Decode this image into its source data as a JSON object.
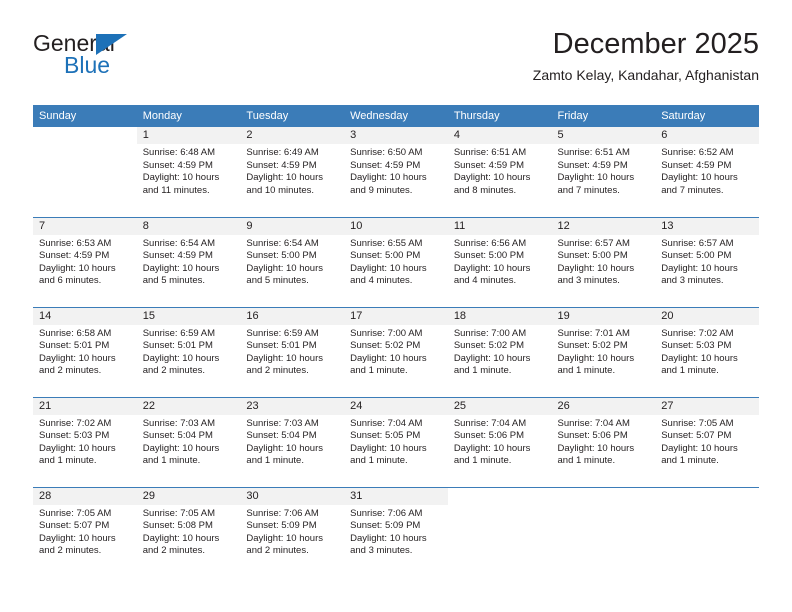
{
  "brand": {
    "name_part1": "General",
    "name_part2": "Blue",
    "triangle_icon": "triangle-icon",
    "colors": {
      "dark": "#231f20",
      "blue": "#1d71b8"
    }
  },
  "header": {
    "title": "December 2025",
    "subtitle": "Zamto Kelay, Kandahar, Afghanistan"
  },
  "calendar": {
    "header_bg": "#3b7cb8",
    "daynum_bg": "#f2f2f2",
    "weekdays": [
      "Sunday",
      "Monday",
      "Tuesday",
      "Wednesday",
      "Thursday",
      "Friday",
      "Saturday"
    ],
    "weeks": [
      [
        {
          "day": ""
        },
        {
          "day": "1",
          "sunrise": "Sunrise: 6:48 AM",
          "sunset": "Sunset: 4:59 PM",
          "daylight1": "Daylight: 10 hours",
          "daylight2": "and 11 minutes."
        },
        {
          "day": "2",
          "sunrise": "Sunrise: 6:49 AM",
          "sunset": "Sunset: 4:59 PM",
          "daylight1": "Daylight: 10 hours",
          "daylight2": "and 10 minutes."
        },
        {
          "day": "3",
          "sunrise": "Sunrise: 6:50 AM",
          "sunset": "Sunset: 4:59 PM",
          "daylight1": "Daylight: 10 hours",
          "daylight2": "and 9 minutes."
        },
        {
          "day": "4",
          "sunrise": "Sunrise: 6:51 AM",
          "sunset": "Sunset: 4:59 PM",
          "daylight1": "Daylight: 10 hours",
          "daylight2": "and 8 minutes."
        },
        {
          "day": "5",
          "sunrise": "Sunrise: 6:51 AM",
          "sunset": "Sunset: 4:59 PM",
          "daylight1": "Daylight: 10 hours",
          "daylight2": "and 7 minutes."
        },
        {
          "day": "6",
          "sunrise": "Sunrise: 6:52 AM",
          "sunset": "Sunset: 4:59 PM",
          "daylight1": "Daylight: 10 hours",
          "daylight2": "and 7 minutes."
        }
      ],
      [
        {
          "day": "7",
          "sunrise": "Sunrise: 6:53 AM",
          "sunset": "Sunset: 4:59 PM",
          "daylight1": "Daylight: 10 hours",
          "daylight2": "and 6 minutes."
        },
        {
          "day": "8",
          "sunrise": "Sunrise: 6:54 AM",
          "sunset": "Sunset: 4:59 PM",
          "daylight1": "Daylight: 10 hours",
          "daylight2": "and 5 minutes."
        },
        {
          "day": "9",
          "sunrise": "Sunrise: 6:54 AM",
          "sunset": "Sunset: 5:00 PM",
          "daylight1": "Daylight: 10 hours",
          "daylight2": "and 5 minutes."
        },
        {
          "day": "10",
          "sunrise": "Sunrise: 6:55 AM",
          "sunset": "Sunset: 5:00 PM",
          "daylight1": "Daylight: 10 hours",
          "daylight2": "and 4 minutes."
        },
        {
          "day": "11",
          "sunrise": "Sunrise: 6:56 AM",
          "sunset": "Sunset: 5:00 PM",
          "daylight1": "Daylight: 10 hours",
          "daylight2": "and 4 minutes."
        },
        {
          "day": "12",
          "sunrise": "Sunrise: 6:57 AM",
          "sunset": "Sunset: 5:00 PM",
          "daylight1": "Daylight: 10 hours",
          "daylight2": "and 3 minutes."
        },
        {
          "day": "13",
          "sunrise": "Sunrise: 6:57 AM",
          "sunset": "Sunset: 5:00 PM",
          "daylight1": "Daylight: 10 hours",
          "daylight2": "and 3 minutes."
        }
      ],
      [
        {
          "day": "14",
          "sunrise": "Sunrise: 6:58 AM",
          "sunset": "Sunset: 5:01 PM",
          "daylight1": "Daylight: 10 hours",
          "daylight2": "and 2 minutes."
        },
        {
          "day": "15",
          "sunrise": "Sunrise: 6:59 AM",
          "sunset": "Sunset: 5:01 PM",
          "daylight1": "Daylight: 10 hours",
          "daylight2": "and 2 minutes."
        },
        {
          "day": "16",
          "sunrise": "Sunrise: 6:59 AM",
          "sunset": "Sunset: 5:01 PM",
          "daylight1": "Daylight: 10 hours",
          "daylight2": "and 2 minutes."
        },
        {
          "day": "17",
          "sunrise": "Sunrise: 7:00 AM",
          "sunset": "Sunset: 5:02 PM",
          "daylight1": "Daylight: 10 hours",
          "daylight2": "and 1 minute."
        },
        {
          "day": "18",
          "sunrise": "Sunrise: 7:00 AM",
          "sunset": "Sunset: 5:02 PM",
          "daylight1": "Daylight: 10 hours",
          "daylight2": "and 1 minute."
        },
        {
          "day": "19",
          "sunrise": "Sunrise: 7:01 AM",
          "sunset": "Sunset: 5:02 PM",
          "daylight1": "Daylight: 10 hours",
          "daylight2": "and 1 minute."
        },
        {
          "day": "20",
          "sunrise": "Sunrise: 7:02 AM",
          "sunset": "Sunset: 5:03 PM",
          "daylight1": "Daylight: 10 hours",
          "daylight2": "and 1 minute."
        }
      ],
      [
        {
          "day": "21",
          "sunrise": "Sunrise: 7:02 AM",
          "sunset": "Sunset: 5:03 PM",
          "daylight1": "Daylight: 10 hours",
          "daylight2": "and 1 minute."
        },
        {
          "day": "22",
          "sunrise": "Sunrise: 7:03 AM",
          "sunset": "Sunset: 5:04 PM",
          "daylight1": "Daylight: 10 hours",
          "daylight2": "and 1 minute."
        },
        {
          "day": "23",
          "sunrise": "Sunrise: 7:03 AM",
          "sunset": "Sunset: 5:04 PM",
          "daylight1": "Daylight: 10 hours",
          "daylight2": "and 1 minute."
        },
        {
          "day": "24",
          "sunrise": "Sunrise: 7:04 AM",
          "sunset": "Sunset: 5:05 PM",
          "daylight1": "Daylight: 10 hours",
          "daylight2": "and 1 minute."
        },
        {
          "day": "25",
          "sunrise": "Sunrise: 7:04 AM",
          "sunset": "Sunset: 5:06 PM",
          "daylight1": "Daylight: 10 hours",
          "daylight2": "and 1 minute."
        },
        {
          "day": "26",
          "sunrise": "Sunrise: 7:04 AM",
          "sunset": "Sunset: 5:06 PM",
          "daylight1": "Daylight: 10 hours",
          "daylight2": "and 1 minute."
        },
        {
          "day": "27",
          "sunrise": "Sunrise: 7:05 AM",
          "sunset": "Sunset: 5:07 PM",
          "daylight1": "Daylight: 10 hours",
          "daylight2": "and 1 minute."
        }
      ],
      [
        {
          "day": "28",
          "sunrise": "Sunrise: 7:05 AM",
          "sunset": "Sunset: 5:07 PM",
          "daylight1": "Daylight: 10 hours",
          "daylight2": "and 2 minutes."
        },
        {
          "day": "29",
          "sunrise": "Sunrise: 7:05 AM",
          "sunset": "Sunset: 5:08 PM",
          "daylight1": "Daylight: 10 hours",
          "daylight2": "and 2 minutes."
        },
        {
          "day": "30",
          "sunrise": "Sunrise: 7:06 AM",
          "sunset": "Sunset: 5:09 PM",
          "daylight1": "Daylight: 10 hours",
          "daylight2": "and 2 minutes."
        },
        {
          "day": "31",
          "sunrise": "Sunrise: 7:06 AM",
          "sunset": "Sunset: 5:09 PM",
          "daylight1": "Daylight: 10 hours",
          "daylight2": "and 3 minutes."
        },
        {
          "day": ""
        },
        {
          "day": ""
        },
        {
          "day": ""
        }
      ]
    ]
  }
}
